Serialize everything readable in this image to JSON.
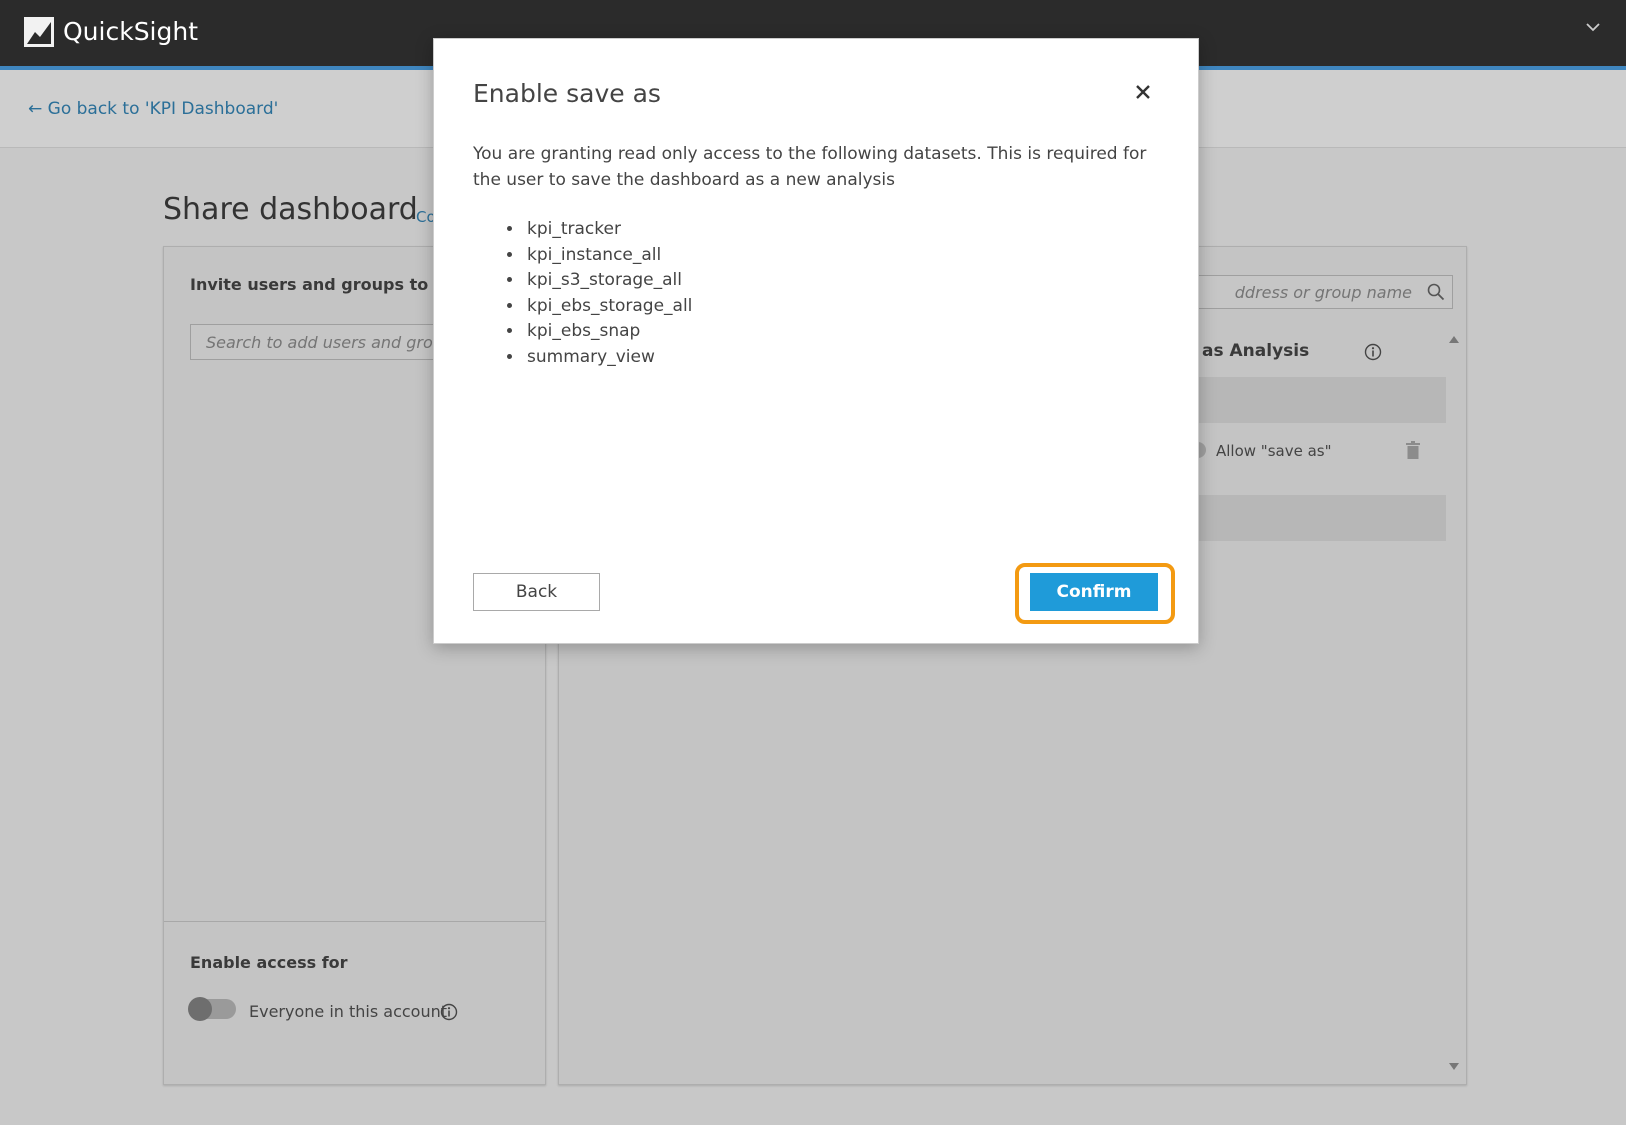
{
  "header": {
    "app_title": "QuickSight"
  },
  "subheader": {
    "back_link": "← Go back to 'KPI Dashboard'"
  },
  "page": {
    "title": "Share dashboard",
    "title_link": "Co"
  },
  "left_panel": {
    "invite_label": "Invite users and groups to da",
    "search_placeholder": "Search to add users and grou",
    "enable_access_label": "Enable access for",
    "everyone_label": "Everyone in this account",
    "everyone_enabled": false
  },
  "right_panel": {
    "search_placeholder": "ddress or group name",
    "column_header": "as Analysis",
    "allow_save_as_label": "Allow \"save as\""
  },
  "modal": {
    "title": "Enable save as",
    "body": "You are granting read only access to the following datasets. This is required for the user to save the dashboard as a new analysis",
    "datasets": [
      "kpi_tracker",
      "kpi_instance_all",
      "kpi_s3_storage_all",
      "kpi_ebs_storage_all",
      "kpi_ebs_snap",
      "summary_view"
    ],
    "back_label": "Back",
    "confirm_label": "Confirm"
  },
  "colors": {
    "topbar": "#2b2b2b",
    "topbar_accent": "#3f86bf",
    "link": "#2b6f98",
    "primary_button": "#1f9bd9",
    "highlight": "#f39a12"
  }
}
